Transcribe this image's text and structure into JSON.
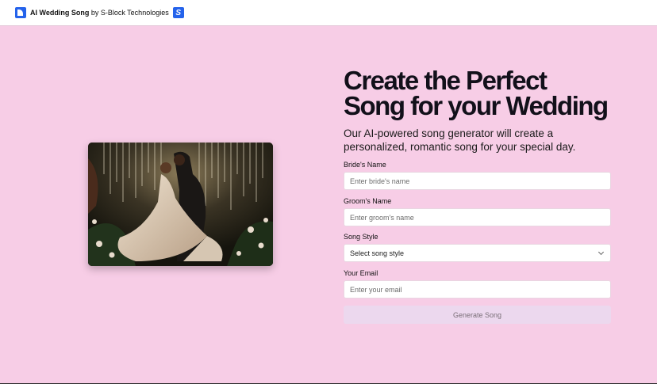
{
  "header": {
    "app_name": "AI Wedding Song",
    "byline": " by S-Block Technologies",
    "logo_icon": "ai-wedding-song-logo-icon",
    "sblock_icon": "s-block-logo-icon",
    "sblock_glyph": "S"
  },
  "hero": {
    "headline": "Create the Perfect Song for your Wedding",
    "subtitle": "Our AI-powered song generator will create a personalized, romantic song for your special day.",
    "image_subject": "couple dancing under string lights"
  },
  "form": {
    "bride": {
      "label": "Bride's Name",
      "placeholder": "Enter bride's name",
      "value": ""
    },
    "groom": {
      "label": "Groom's Name",
      "placeholder": "Enter groom's name",
      "value": ""
    },
    "style": {
      "label": "Song Style",
      "selected": "Select song style"
    },
    "email": {
      "label": "Your Email",
      "placeholder": "Enter your email",
      "value": ""
    },
    "submit_label": "Generate Song"
  },
  "colors": {
    "page_bg": "#f7cde6",
    "accent": "#2563eb",
    "button_disabled_bg": "#ecd8ee"
  }
}
